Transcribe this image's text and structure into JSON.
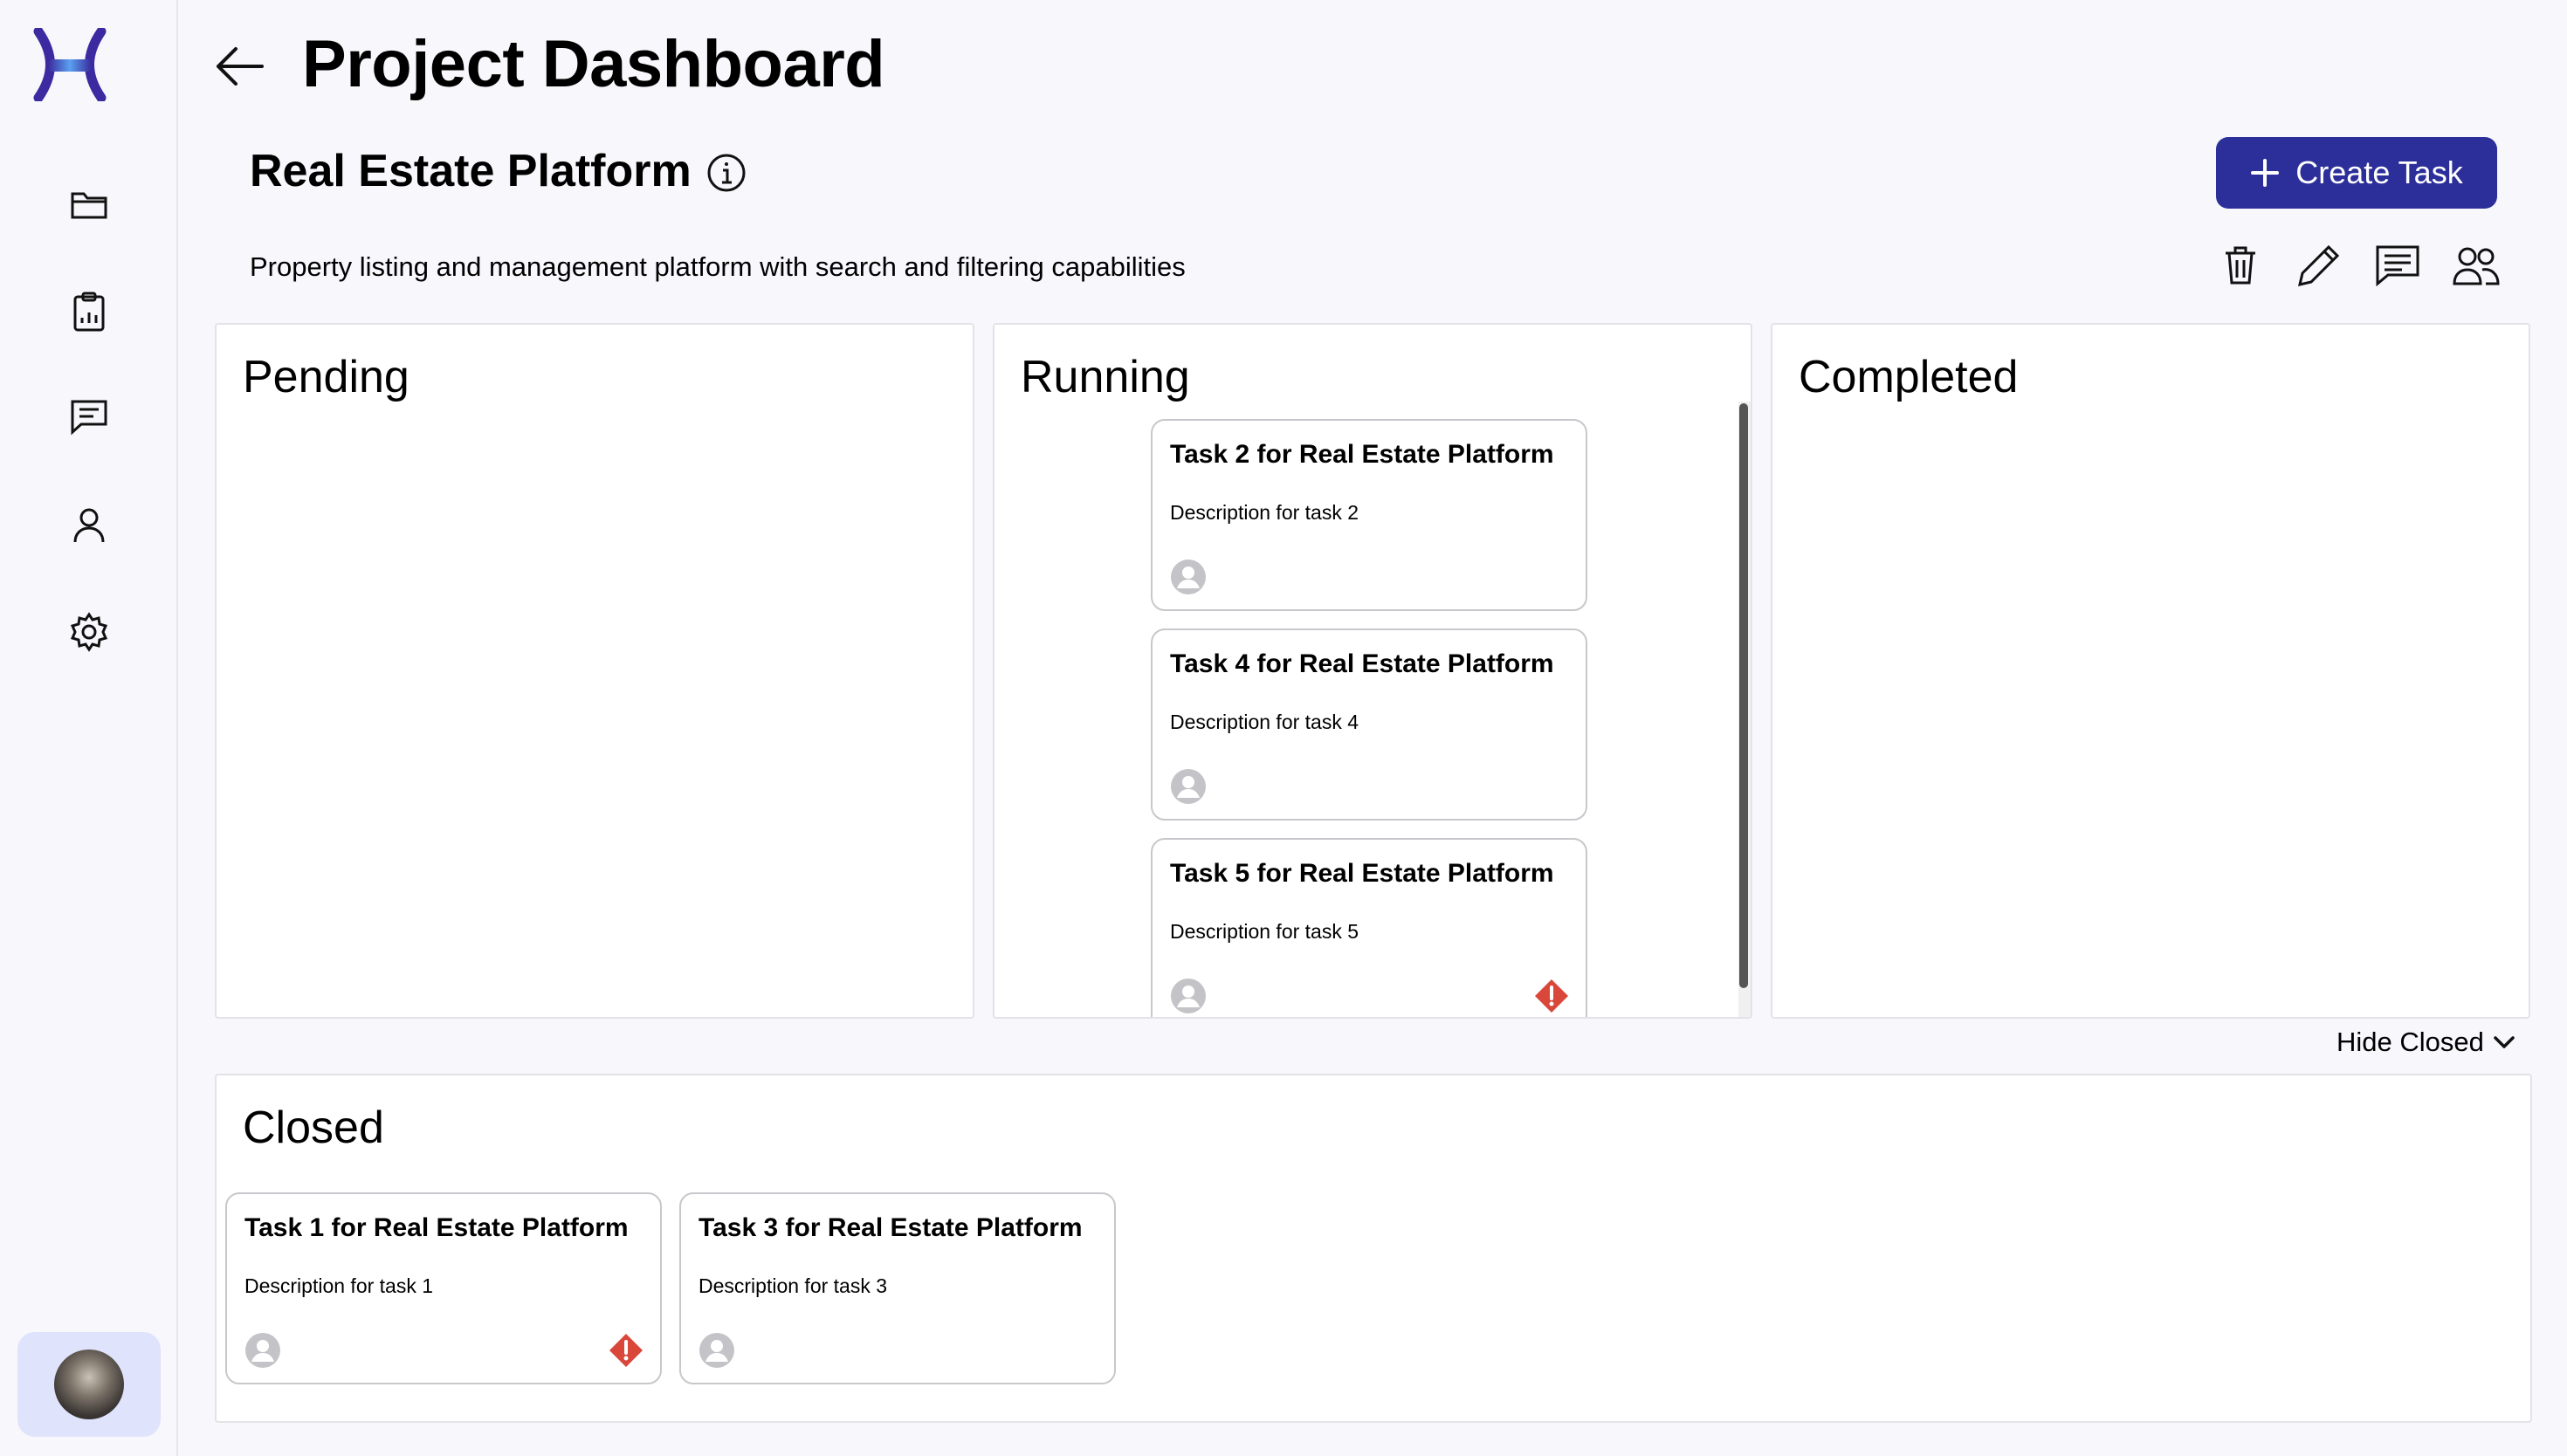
{
  "header": {
    "page_title": "Project Dashboard"
  },
  "project": {
    "name": "Real Estate Platform",
    "description": "Property listing and management platform with search and filtering capabilities"
  },
  "actions": {
    "create_task_label": "Create Task",
    "hide_closed_label": "Hide Closed"
  },
  "sidebar": {
    "icons": [
      "folder-icon",
      "report-icon",
      "chat-icon",
      "user-icon",
      "settings-icon"
    ]
  },
  "toolbar_icons": [
    "trash-icon",
    "pencil-icon",
    "comment-icon",
    "team-icon"
  ],
  "columns": {
    "pending": {
      "title": "Pending"
    },
    "running": {
      "title": "Running"
    },
    "completed": {
      "title": "Completed"
    },
    "closed": {
      "title": "Closed"
    }
  },
  "running_tasks": [
    {
      "title": "Task 2 for Real Estate Platform",
      "description": "Description for task 2",
      "alert": false
    },
    {
      "title": "Task 4 for Real Estate Platform",
      "description": "Description for task 4",
      "alert": false
    },
    {
      "title": "Task 5 for Real Estate Platform",
      "description": "Description for task 5",
      "alert": true
    }
  ],
  "closed_tasks": [
    {
      "title": "Task 1 for Real Estate Platform",
      "description": "Description for task 1",
      "alert": true
    },
    {
      "title": "Task 3 for Real Estate Platform",
      "description": "Description for task 3",
      "alert": false
    }
  ],
  "colors": {
    "accent": "#2c2f9a",
    "alert": "#d9463a",
    "background": "#f7f7fc"
  }
}
